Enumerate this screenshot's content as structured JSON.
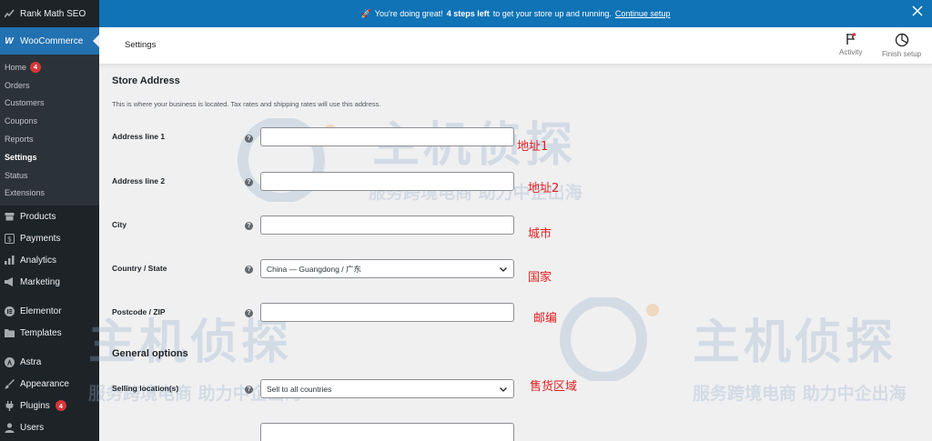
{
  "sidebar": {
    "top_item": "Rank Math SEO",
    "woocommerce": "WooCommerce",
    "sub_items": [
      {
        "label": "Home",
        "badge": "4"
      },
      {
        "label": "Orders"
      },
      {
        "label": "Customers"
      },
      {
        "label": "Coupons"
      },
      {
        "label": "Reports"
      },
      {
        "label": "Settings",
        "active": true
      },
      {
        "label": "Status"
      },
      {
        "label": "Extensions"
      }
    ],
    "main_items": [
      {
        "label": "Products",
        "icon": "archive-icon"
      },
      {
        "label": "Payments",
        "icon": "dollar-icon"
      },
      {
        "label": "Analytics",
        "icon": "bar-chart-icon"
      },
      {
        "label": "Marketing",
        "icon": "megaphone-icon"
      },
      {
        "label": "Elementor",
        "icon": "elementor-icon"
      },
      {
        "label": "Templates",
        "icon": "folder-icon"
      },
      {
        "label": "Astra",
        "icon": "astra-icon"
      },
      {
        "label": "Appearance",
        "icon": "brush-icon"
      },
      {
        "label": "Plugins",
        "icon": "plug-icon",
        "badge": "4"
      },
      {
        "label": "Users",
        "icon": "user-icon"
      }
    ]
  },
  "notice": {
    "emoji": "🚀",
    "text_before": "You're doing great!",
    "bold": "4 steps left",
    "text_after": "to get your store up and running.",
    "link": "Continue setup"
  },
  "header": {
    "title": "Settings",
    "activity": "Activity",
    "finish_setup": "Finish setup"
  },
  "store_address": {
    "title": "Store Address",
    "description": "This is where your business is located. Tax rates and shipping rates will use this address.",
    "fields": [
      {
        "label": "Address line 1",
        "value": "",
        "annotation": "地址1"
      },
      {
        "label": "Address line 2",
        "value": "",
        "annotation": "地址2"
      },
      {
        "label": "City",
        "value": "",
        "annotation": "城市"
      },
      {
        "label": "Country / State",
        "value": "China — Guangdong / 广东",
        "annotation": "国家"
      },
      {
        "label": "Postcode / ZIP",
        "value": "",
        "annotation": "邮编"
      }
    ]
  },
  "general_options": {
    "title": "General options",
    "fields": [
      {
        "label": "Selling location(s)",
        "value": "Sell to all countries",
        "annotation": "售货区域"
      }
    ]
  },
  "watermark": {
    "brand": "主机侦探",
    "slogan": "服务跨境电商 助力中企出海"
  },
  "colors": {
    "sidebar_bg": "#1d2327",
    "accent": "#2271b1",
    "notice_bg": "#0f73b6",
    "annotation": "#e02020",
    "badge": "#d63638"
  }
}
